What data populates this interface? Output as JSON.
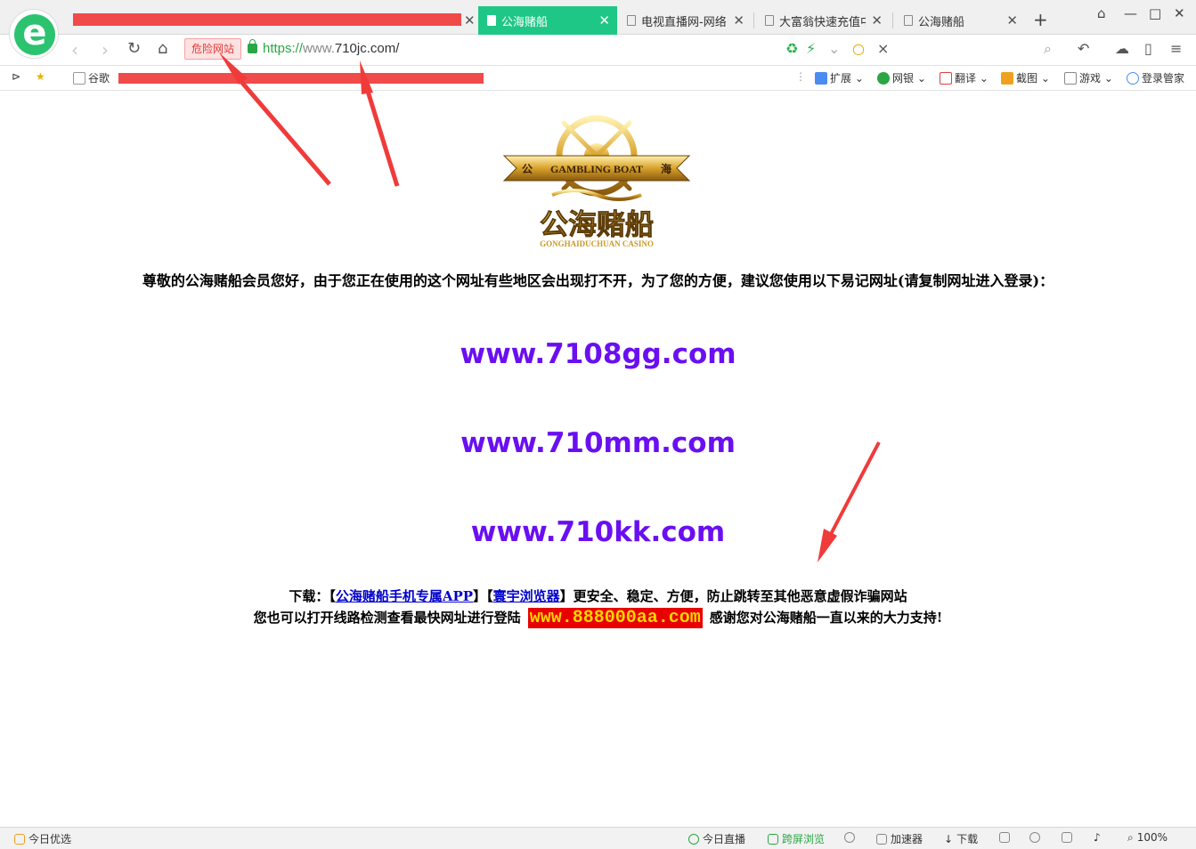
{
  "tabs": [
    {
      "title": "",
      "redacted": true
    },
    {
      "title": "公海赌船",
      "active": true
    },
    {
      "title": "电视直播网-网络电"
    },
    {
      "title": "大富翁快速充值中心"
    },
    {
      "title": "公海赌船"
    }
  ],
  "window_controls": {
    "skin": "shirt-icon",
    "minimize": "—",
    "maximize": "□",
    "close": "✕"
  },
  "address": {
    "danger_label": "危险网站",
    "scheme": "https://",
    "host_prefix": "www.",
    "host": "710jc.com/",
    "search_x": "×"
  },
  "bookmarks": {
    "google": "谷歌",
    "extensions": "扩展",
    "netbank": "网银",
    "translate": "翻译",
    "screenshot": "截图",
    "games": "游戏",
    "login_manager": "登录管家"
  },
  "page": {
    "logo_banner": "GAMBLING BOAT",
    "logo_left_char": "公",
    "logo_right_char": "海",
    "logo_cn": "公海赌船",
    "logo_en": "GONGHAIDUCHUAN CASINO",
    "notice": "尊敬的公海赌船会员您好，由于您正在使用的这个网址有些地区会出现打不开，为了您的方便，建议您使用以下易记网址(请复制网址进入登录)：",
    "links": [
      "www.7108gg.com",
      "www.710mm.com",
      "www.710kk.com"
    ],
    "download_prefix": "下载：【",
    "app_link": "公海赌船手机专属APP",
    "mid": "】【",
    "browser_link": "寰宇浏览器",
    "download_suffix": "】更安全、稳定、方便，防止跳转至其他恶意虚假诈骗网站",
    "check_prefix": "您也可以打开线路检测查看最快网址进行登陆",
    "check_url": "www.888000aa.com",
    "check_suffix": "感谢您对公海赌船一直以来的大力支持!"
  },
  "status": {
    "today_pick": "今日优选",
    "today_live": "今日直播",
    "cross_screen": "跨屏浏览",
    "accelerator": "加速器",
    "download": "下载",
    "zoom": "100%"
  },
  "colors": {
    "active_tab": "#1ec785",
    "link_purple": "#6a0ff1",
    "danger": "#e23636",
    "highlight_bg": "#e80000",
    "highlight_fg": "#ffd400",
    "annotation": "#f03b3b"
  }
}
